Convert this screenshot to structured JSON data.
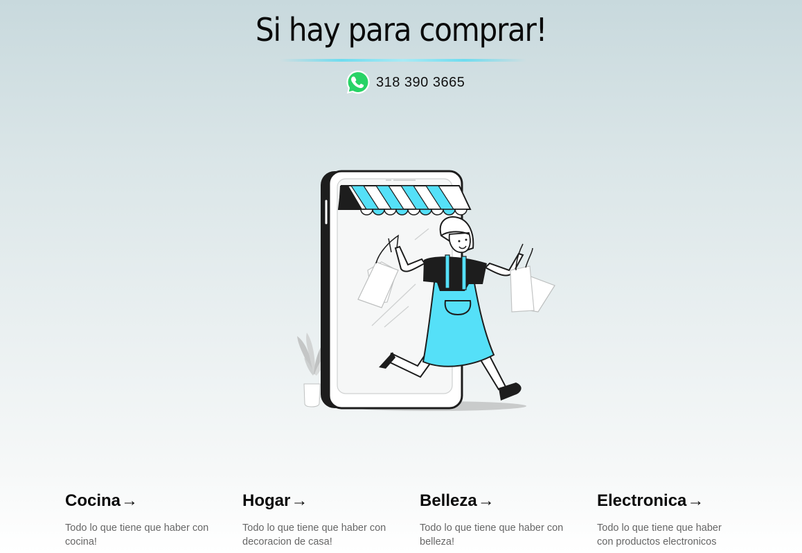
{
  "header": {
    "title": "Si hay para comprar!",
    "whatsapp_icon": "whatsapp-icon",
    "phone": "318 390 3665"
  },
  "hero": {
    "illustration": "shopping-woman-phone-illustration",
    "accent_color": "#55e0f8"
  },
  "categories": [
    {
      "title": "Cocina",
      "arrow": "→",
      "description": "Todo lo que tiene que haber con cocina!"
    },
    {
      "title": "Hogar",
      "arrow": "→",
      "description": "Todo lo que tiene que haber con decoracion de casa!"
    },
    {
      "title": "Belleza",
      "arrow": "→",
      "description": "Todo lo que tiene que haber con belleza!"
    },
    {
      "title": "Electronica",
      "arrow": "→",
      "description": "Todo lo que tiene que haber con productos electronicos"
    }
  ],
  "colors": {
    "accent": "#55e0f8",
    "whatsapp_green": "#25d366"
  }
}
